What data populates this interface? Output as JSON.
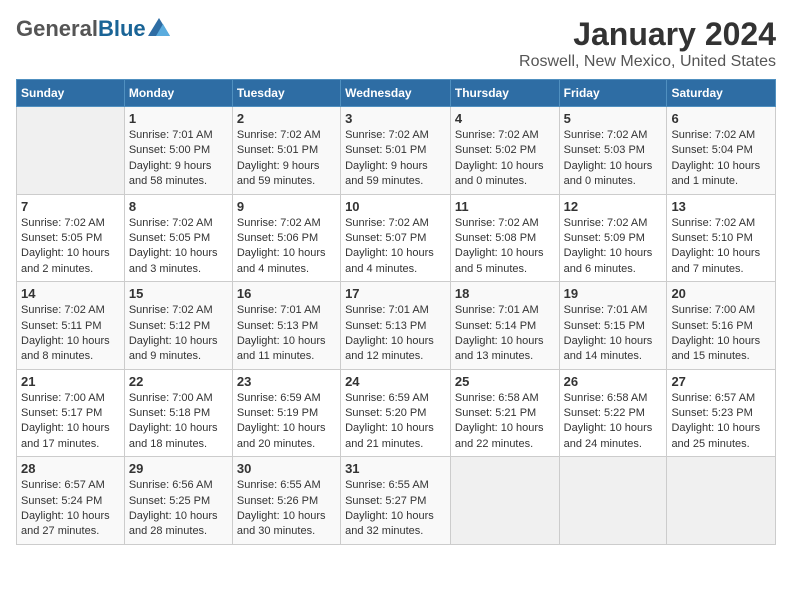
{
  "header": {
    "logo_general": "General",
    "logo_blue": "Blue",
    "title": "January 2024",
    "subtitle": "Roswell, New Mexico, United States"
  },
  "calendar": {
    "days_of_week": [
      "Sunday",
      "Monday",
      "Tuesday",
      "Wednesday",
      "Thursday",
      "Friday",
      "Saturday"
    ],
    "weeks": [
      [
        {
          "day": "",
          "info": ""
        },
        {
          "day": "1",
          "info": "Sunrise: 7:01 AM\nSunset: 5:00 PM\nDaylight: 9 hours\nand 58 minutes."
        },
        {
          "day": "2",
          "info": "Sunrise: 7:02 AM\nSunset: 5:01 PM\nDaylight: 9 hours\nand 59 minutes."
        },
        {
          "day": "3",
          "info": "Sunrise: 7:02 AM\nSunset: 5:01 PM\nDaylight: 9 hours\nand 59 minutes."
        },
        {
          "day": "4",
          "info": "Sunrise: 7:02 AM\nSunset: 5:02 PM\nDaylight: 10 hours\nand 0 minutes."
        },
        {
          "day": "5",
          "info": "Sunrise: 7:02 AM\nSunset: 5:03 PM\nDaylight: 10 hours\nand 0 minutes."
        },
        {
          "day": "6",
          "info": "Sunrise: 7:02 AM\nSunset: 5:04 PM\nDaylight: 10 hours\nand 1 minute."
        }
      ],
      [
        {
          "day": "7",
          "info": "Sunrise: 7:02 AM\nSunset: 5:05 PM\nDaylight: 10 hours\nand 2 minutes."
        },
        {
          "day": "8",
          "info": "Sunrise: 7:02 AM\nSunset: 5:05 PM\nDaylight: 10 hours\nand 3 minutes."
        },
        {
          "day": "9",
          "info": "Sunrise: 7:02 AM\nSunset: 5:06 PM\nDaylight: 10 hours\nand 4 minutes."
        },
        {
          "day": "10",
          "info": "Sunrise: 7:02 AM\nSunset: 5:07 PM\nDaylight: 10 hours\nand 4 minutes."
        },
        {
          "day": "11",
          "info": "Sunrise: 7:02 AM\nSunset: 5:08 PM\nDaylight: 10 hours\nand 5 minutes."
        },
        {
          "day": "12",
          "info": "Sunrise: 7:02 AM\nSunset: 5:09 PM\nDaylight: 10 hours\nand 6 minutes."
        },
        {
          "day": "13",
          "info": "Sunrise: 7:02 AM\nSunset: 5:10 PM\nDaylight: 10 hours\nand 7 minutes."
        }
      ],
      [
        {
          "day": "14",
          "info": "Sunrise: 7:02 AM\nSunset: 5:11 PM\nDaylight: 10 hours\nand 8 minutes."
        },
        {
          "day": "15",
          "info": "Sunrise: 7:02 AM\nSunset: 5:12 PM\nDaylight: 10 hours\nand 9 minutes."
        },
        {
          "day": "16",
          "info": "Sunrise: 7:01 AM\nSunset: 5:13 PM\nDaylight: 10 hours\nand 11 minutes."
        },
        {
          "day": "17",
          "info": "Sunrise: 7:01 AM\nSunset: 5:13 PM\nDaylight: 10 hours\nand 12 minutes."
        },
        {
          "day": "18",
          "info": "Sunrise: 7:01 AM\nSunset: 5:14 PM\nDaylight: 10 hours\nand 13 minutes."
        },
        {
          "day": "19",
          "info": "Sunrise: 7:01 AM\nSunset: 5:15 PM\nDaylight: 10 hours\nand 14 minutes."
        },
        {
          "day": "20",
          "info": "Sunrise: 7:00 AM\nSunset: 5:16 PM\nDaylight: 10 hours\nand 15 minutes."
        }
      ],
      [
        {
          "day": "21",
          "info": "Sunrise: 7:00 AM\nSunset: 5:17 PM\nDaylight: 10 hours\nand 17 minutes."
        },
        {
          "day": "22",
          "info": "Sunrise: 7:00 AM\nSunset: 5:18 PM\nDaylight: 10 hours\nand 18 minutes."
        },
        {
          "day": "23",
          "info": "Sunrise: 6:59 AM\nSunset: 5:19 PM\nDaylight: 10 hours\nand 20 minutes."
        },
        {
          "day": "24",
          "info": "Sunrise: 6:59 AM\nSunset: 5:20 PM\nDaylight: 10 hours\nand 21 minutes."
        },
        {
          "day": "25",
          "info": "Sunrise: 6:58 AM\nSunset: 5:21 PM\nDaylight: 10 hours\nand 22 minutes."
        },
        {
          "day": "26",
          "info": "Sunrise: 6:58 AM\nSunset: 5:22 PM\nDaylight: 10 hours\nand 24 minutes."
        },
        {
          "day": "27",
          "info": "Sunrise: 6:57 AM\nSunset: 5:23 PM\nDaylight: 10 hours\nand 25 minutes."
        }
      ],
      [
        {
          "day": "28",
          "info": "Sunrise: 6:57 AM\nSunset: 5:24 PM\nDaylight: 10 hours\nand 27 minutes."
        },
        {
          "day": "29",
          "info": "Sunrise: 6:56 AM\nSunset: 5:25 PM\nDaylight: 10 hours\nand 28 minutes."
        },
        {
          "day": "30",
          "info": "Sunrise: 6:55 AM\nSunset: 5:26 PM\nDaylight: 10 hours\nand 30 minutes."
        },
        {
          "day": "31",
          "info": "Sunrise: 6:55 AM\nSunset: 5:27 PM\nDaylight: 10 hours\nand 32 minutes."
        },
        {
          "day": "",
          "info": ""
        },
        {
          "day": "",
          "info": ""
        },
        {
          "day": "",
          "info": ""
        }
      ]
    ]
  }
}
